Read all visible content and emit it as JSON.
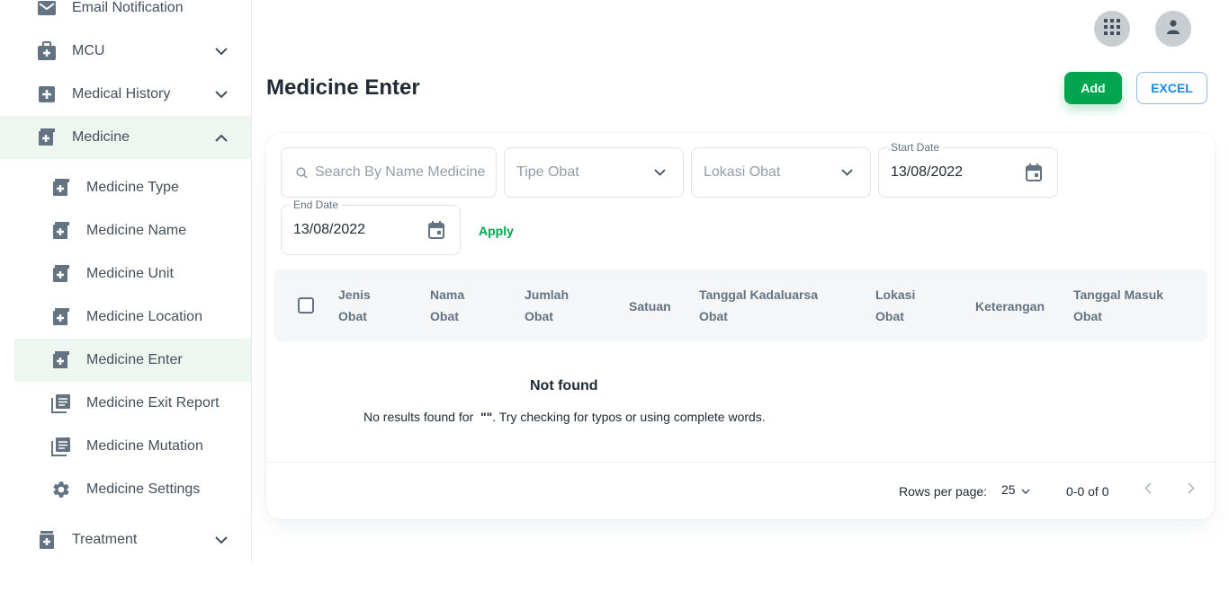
{
  "sidebar": {
    "items": [
      {
        "label": "Email Notification",
        "icon": "mail-icon"
      },
      {
        "label": "MCU",
        "icon": "medical-bag-icon"
      },
      {
        "label": "Medical History",
        "icon": "plus-box-icon"
      },
      {
        "label": "Medicine",
        "icon": "medicine-icon"
      },
      {
        "label": "Treatment",
        "icon": "treatment-icon"
      }
    ],
    "medicine_sub": [
      {
        "label": "Medicine Type",
        "icon": "medicine-icon"
      },
      {
        "label": "Medicine Name",
        "icon": "medicine-icon"
      },
      {
        "label": "Medicine Unit",
        "icon": "medicine-icon"
      },
      {
        "label": "Medicine Location",
        "icon": "medicine-icon"
      },
      {
        "label": "Medicine Enter",
        "icon": "medicine-icon"
      },
      {
        "label": "Medicine Exit Report",
        "icon": "report-icon"
      },
      {
        "label": "Medicine Mutation",
        "icon": "report-icon"
      },
      {
        "label": "Medicine Settings",
        "icon": "gear-icon"
      }
    ]
  },
  "header": {
    "title": "Medicine Enter",
    "add_label": "Add",
    "excel_label": "EXCEL"
  },
  "filters": {
    "search_placeholder": "Search By Name Medicine",
    "type_placeholder": "Tipe Obat",
    "location_placeholder": "Lokasi Obat",
    "start_date_label": "Start Date",
    "start_date_value": "13/08/2022",
    "end_date_label": "End Date",
    "end_date_value": "13/08/2022",
    "apply_label": "Apply"
  },
  "table": {
    "columns": [
      {
        "line1": "Jenis",
        "line2": "Obat"
      },
      {
        "line1": "Nama",
        "line2": "Obat"
      },
      {
        "line1": "Jumlah",
        "line2": "Obat"
      },
      {
        "line1": "Satuan",
        "line2": ""
      },
      {
        "line1": "Tanggal Kadaluarsa",
        "line2": "Obat"
      },
      {
        "line1": "Lokasi",
        "line2": "Obat"
      },
      {
        "line1": "Keterangan",
        "line2": ""
      },
      {
        "line1": "Tanggal Masuk",
        "line2": "Obat"
      }
    ],
    "empty_title": "Not found",
    "empty_text_prefix": "No results found for",
    "empty_query": "\"\"",
    "empty_text_suffix": ". Try checking for typos or using complete words."
  },
  "pagination": {
    "rows_per_page_label": "Rows per page:",
    "rows_per_page_value": "25",
    "range_text": "0-0 of 0"
  },
  "colors": {
    "accent": "#00a54f",
    "active_bg": "#edf6ef",
    "excel": "#1e88e5"
  }
}
